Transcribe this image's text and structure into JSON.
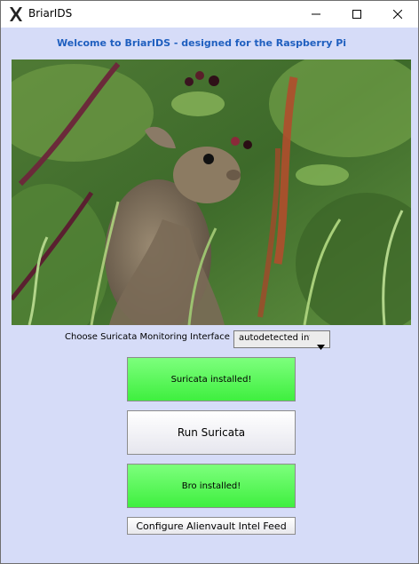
{
  "window": {
    "title": "BriarIDS",
    "app_icon": "x-logo-icon",
    "controls": {
      "minimize": "minimize-icon",
      "maximize": "maximize-icon",
      "close": "close-icon"
    }
  },
  "main": {
    "welcome": "Welcome to BriarIDS - designed for the Raspberry Pi",
    "photo": "rabbit-in-brambles-photo",
    "interface_label": "Choose Suricata Monitoring Interface",
    "interface_select_value": "autodetected interface",
    "buttons": {
      "suricata_status": "Suricata installed!",
      "run_suricata": "Run Suricata",
      "bro_status": "Bro installed!",
      "configure_feed": "Configure Alienvault Intel Feed"
    }
  },
  "colors": {
    "background": "#d6dcf8",
    "welcome_text": "#1f5fbf",
    "installed_button": "#4cf44c"
  }
}
